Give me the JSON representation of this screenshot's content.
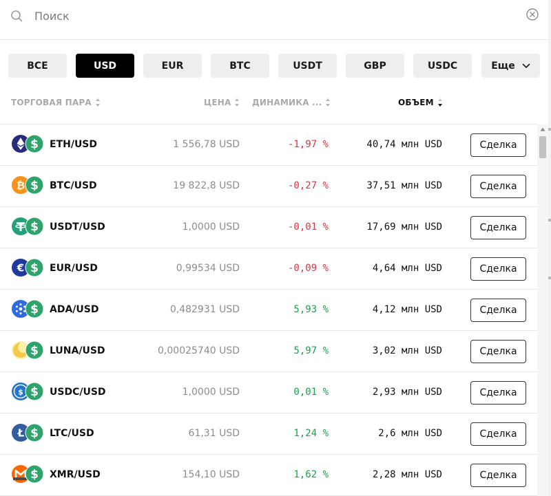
{
  "search": {
    "placeholder": "Поиск"
  },
  "filters": [
    "ВСЕ",
    "USD",
    "EUR",
    "BTC",
    "USDT",
    "GBP",
    "USDC"
  ],
  "filters_active": "USD",
  "more_label": "Еще",
  "columns": {
    "pair": "ТОРГОВАЯ ПАРА",
    "price": "ЦЕНА",
    "change": "ДИНАМИКА ...",
    "volume": "ОБЪЕМ"
  },
  "trade_label": "Сделка",
  "quote_icon": {
    "name": "usd-coin-icon",
    "color": "#2ea36b"
  },
  "rows": [
    {
      "pair": "ETH/USD",
      "price": "1 556,78 USD",
      "change": "-1,97 %",
      "trend": "neg",
      "volume": "40,74 млн USD",
      "base_icon": "ethereum-icon",
      "base_color": "#2a2a7a"
    },
    {
      "pair": "BTC/USD",
      "price": "19 822,8 USD",
      "change": "-0,27 %",
      "trend": "neg",
      "volume": "37,51 млн USD",
      "base_icon": "bitcoin-icon",
      "base_color": "#f7931a"
    },
    {
      "pair": "USDT/USD",
      "price": "1,0000 USD",
      "change": "-0,01 %",
      "trend": "neg",
      "volume": "17,69 млн USD",
      "base_icon": "tether-icon",
      "base_color": "#26a17b"
    },
    {
      "pair": "EUR/USD",
      "price": "0,99534 USD",
      "change": "-0,09 %",
      "trend": "neg",
      "volume": "4,64 млн USD",
      "base_icon": "euro-icon",
      "base_color": "#1e3a9a"
    },
    {
      "pair": "ADA/USD",
      "price": "0,482931 USD",
      "change": "5,93 %",
      "trend": "pos",
      "volume": "4,12 млн USD",
      "base_icon": "cardano-icon",
      "base_color": "#2f6ae0"
    },
    {
      "pair": "LUNA/USD",
      "price": "0,00025740 USD",
      "change": "5,97 %",
      "trend": "pos",
      "volume": "3,02 млн USD",
      "base_icon": "luna-icon",
      "base_color": "#f4e27a"
    },
    {
      "pair": "USDC/USD",
      "price": "1,0000 USD",
      "change": "0,01 %",
      "trend": "pos",
      "volume": "2,93 млн USD",
      "base_icon": "usdc-icon",
      "base_color": "#2775ca"
    },
    {
      "pair": "LTC/USD",
      "price": "61,31 USD",
      "change": "1,24 %",
      "trend": "pos",
      "volume": "2,6 млн USD",
      "base_icon": "litecoin-icon",
      "base_color": "#345d9d"
    },
    {
      "pair": "XMR/USD",
      "price": "154,10 USD",
      "change": "1,62 %",
      "trend": "pos",
      "volume": "2,28 млн USD",
      "base_icon": "monero-icon",
      "base_color": "#ff6600"
    }
  ]
}
